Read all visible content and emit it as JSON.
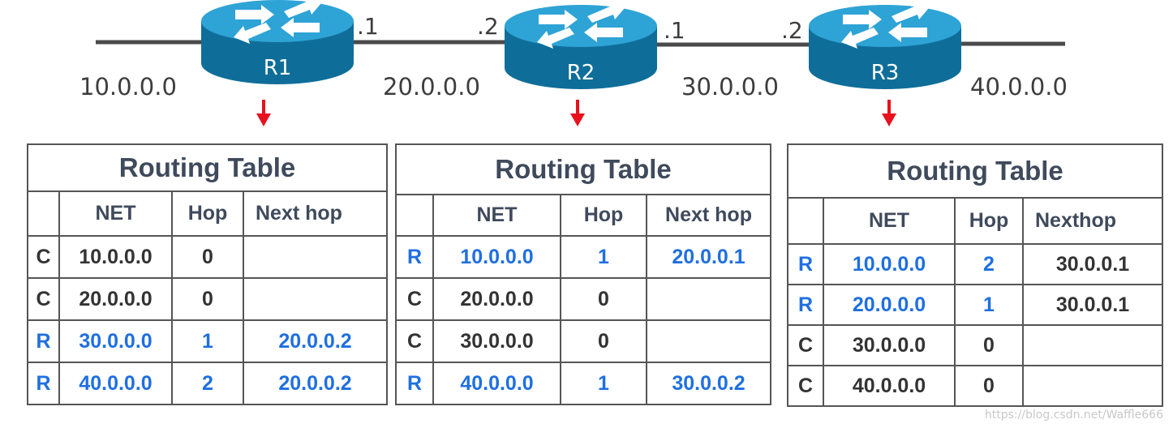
{
  "topology": {
    "networks": [
      "10.0.0.0",
      "20.0.0.0",
      "30.0.0.0",
      "40.0.0.0"
    ],
    "routers": [
      {
        "name": "R1",
        "left_if": "",
        "right_if": ".1"
      },
      {
        "name": "R2",
        "left_if": ".2",
        "right_if": ".1"
      },
      {
        "name": "R3",
        "left_if": ".2",
        "right_if": ""
      }
    ],
    "colors": {
      "router_top": "#2ea3d6",
      "router_side": "#0f6e99",
      "link": "#4a4a4a",
      "arrow": "#e8111d"
    }
  },
  "tables": [
    {
      "title": "Routing Table",
      "headers": {
        "net": "NET",
        "hop": "Hop",
        "next": "Next hop"
      },
      "rows": [
        {
          "type": "C",
          "net": "10.0.0.0",
          "hop": "0",
          "next": "",
          "rip": false
        },
        {
          "type": "C",
          "net": "20.0.0.0",
          "hop": "0",
          "next": "",
          "rip": false
        },
        {
          "type": "R",
          "net": "30.0.0.0",
          "hop": "1",
          "next": "20.0.0.2",
          "rip": true
        },
        {
          "type": "R",
          "net": "40.0.0.0",
          "hop": "2",
          "next": "20.0.0.2",
          "rip": true
        }
      ]
    },
    {
      "title": "Routing Table",
      "headers": {
        "net": "NET",
        "hop": "Hop",
        "next": "Next hop"
      },
      "rows": [
        {
          "type": "R",
          "net": "10.0.0.0",
          "hop": "1",
          "next": "20.0.0.1",
          "rip": true
        },
        {
          "type": "C",
          "net": "20.0.0.0",
          "hop": "0",
          "next": "",
          "rip": false
        },
        {
          "type": "C",
          "net": "30.0.0.0",
          "hop": "0",
          "next": "",
          "rip": false
        },
        {
          "type": "R",
          "net": "40.0.0.0",
          "hop": "1",
          "next": "30.0.0.2",
          "rip": true
        }
      ]
    },
    {
      "title": "Routing Table",
      "headers": {
        "net": "NET",
        "hop": "Hop",
        "next": "Nexthop"
      },
      "rows": [
        {
          "type": "R",
          "net": "10.0.0.0",
          "hop": "2",
          "next": "30.0.0.1",
          "rip": true
        },
        {
          "type": "R",
          "net": "20.0.0.0",
          "hop": "1",
          "next": "30.0.0.1",
          "rip": true
        },
        {
          "type": "C",
          "net": "30.0.0.0",
          "hop": "0",
          "next": "",
          "rip": false
        },
        {
          "type": "C",
          "net": "40.0.0.0",
          "hop": "0",
          "next": "",
          "rip": false
        }
      ]
    }
  ],
  "watermark": "https://blog.csdn.net/Waffle666"
}
